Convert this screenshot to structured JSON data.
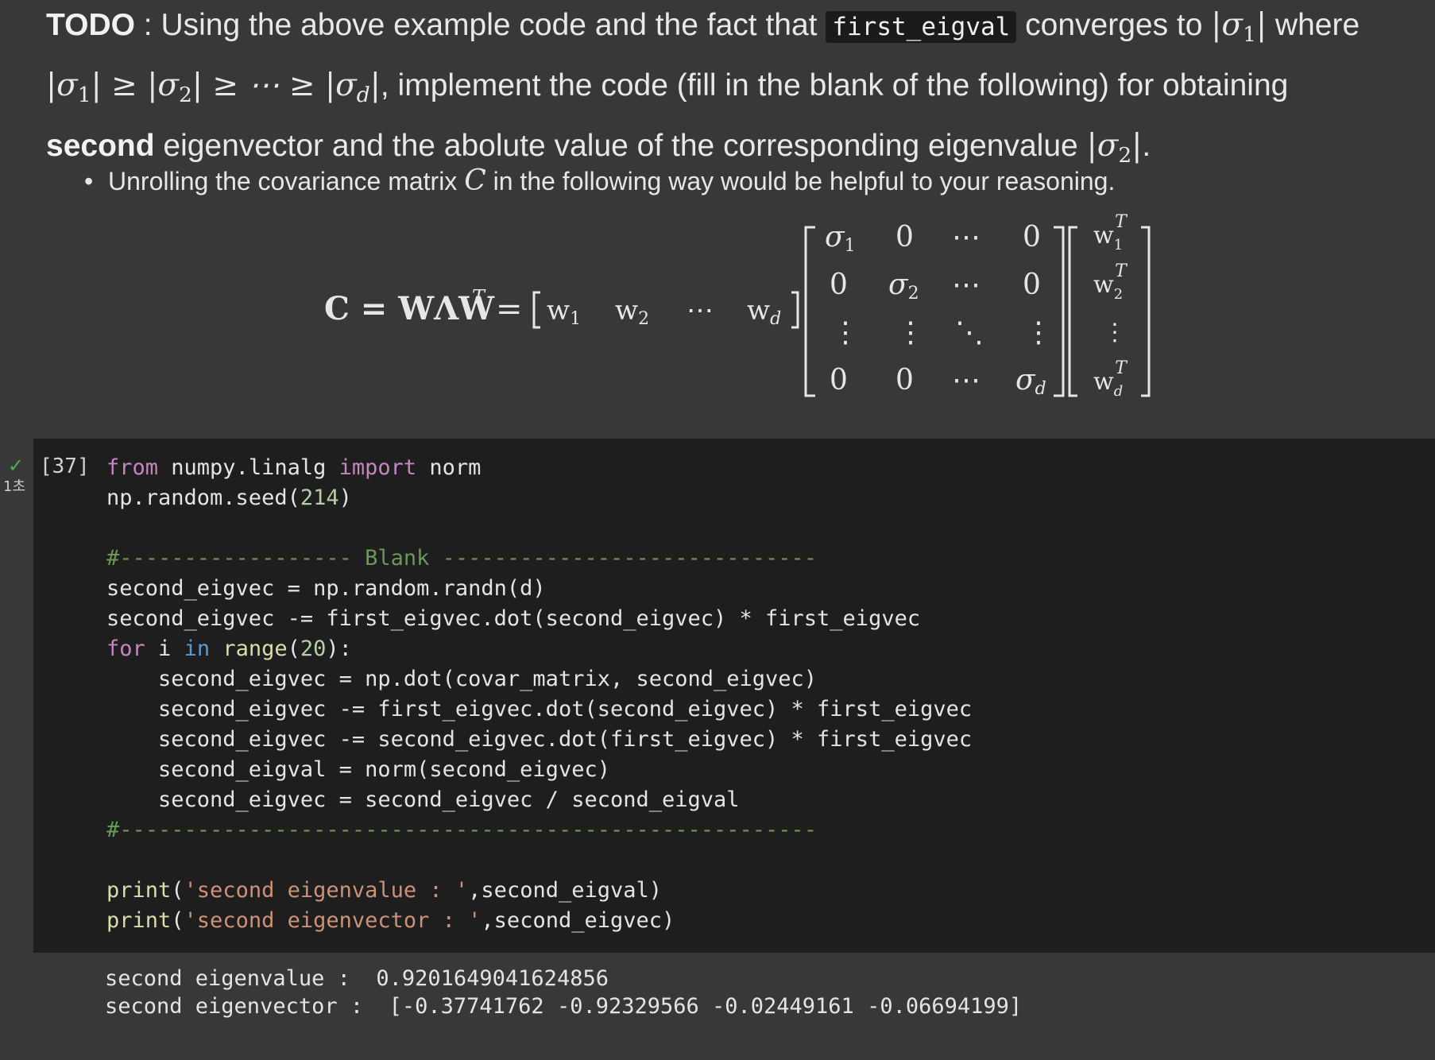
{
  "markdown": {
    "todo_label": "TODO",
    "intro_1": " : Using the above example code and the fact that ",
    "inline_code": "first_eigval",
    "intro_2": " converges to ",
    "intro_3": " where",
    "intro_4": ", implement the code (fill in the blank of the following) for obtaining",
    "bold_word": "second",
    "intro_5": " eigenvector and the abolute value of the corresponding eigenvalue ",
    "bullet_text_1": "Unrolling the covariance matrix ",
    "bullet_var": "C",
    "bullet_text_2": " in the following way would be helpful to your reasoning."
  },
  "code_cell": {
    "execution_count": "[37]",
    "status_icon": "checkmark-icon",
    "run_time": "1초"
  },
  "output": {
    "line1": "second eigenvalue :  0.9201649041624856",
    "line2": "second eigenvector :  [-0.37741762 -0.92329566 -0.02449161 -0.06694199]"
  }
}
